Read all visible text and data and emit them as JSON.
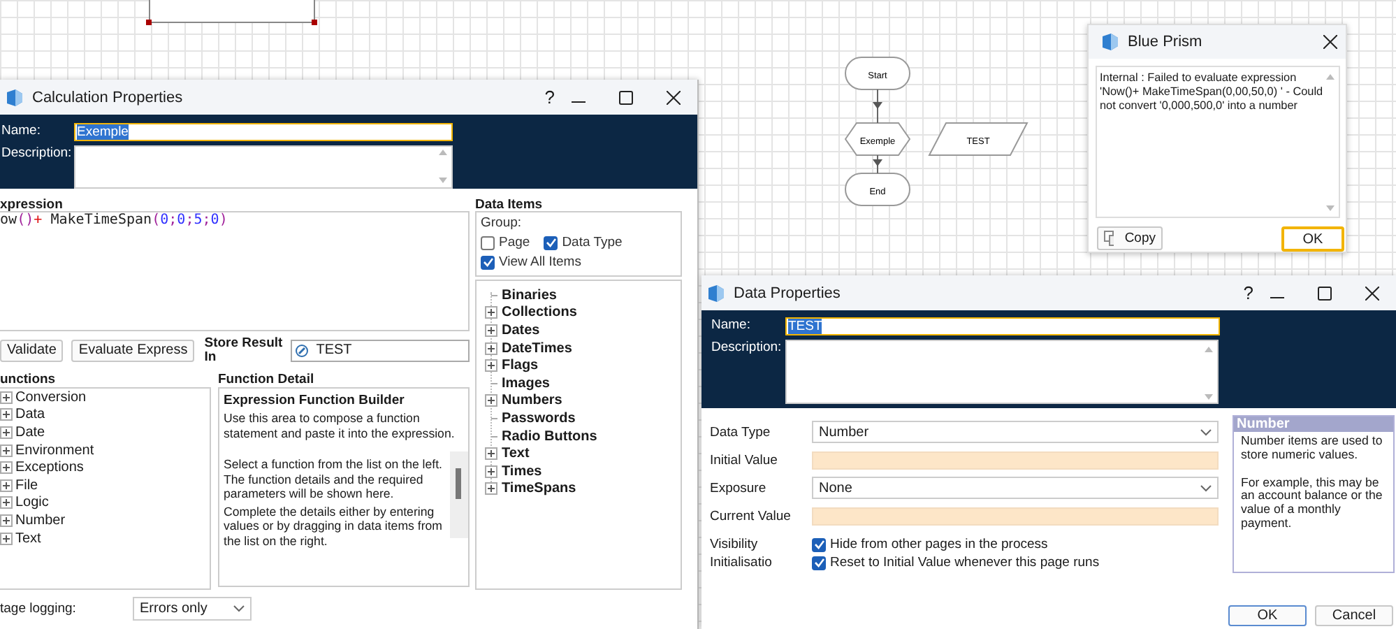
{
  "canvas": {
    "flowchart": [
      {
        "kind": "terminal",
        "label": "Start"
      },
      {
        "kind": "process",
        "label": "Exemple"
      },
      {
        "kind": "data",
        "label": "TEST"
      },
      {
        "kind": "terminal",
        "label": "End"
      }
    ]
  },
  "calculation": {
    "title": "Calculation Properties",
    "help": "?",
    "name_label": "Name:",
    "name": "Exemple",
    "name_selected": true,
    "description_label": "Description:",
    "expression_label": "xpression",
    "expression": "ow()+ MakeTimeSpan(0;0;5;0)",
    "buttons": [
      "Validate",
      "Evaluate Express"
    ],
    "store_result_label": "Store Result In",
    "store_result": "TEST",
    "functions_label": "unctions",
    "functions": [
      "Conversion",
      "Data",
      "Date",
      "Environment",
      "Exceptions",
      "File",
      "Logic",
      "Number",
      "Text"
    ],
    "function_detail_label": "Function Detail",
    "detail_title": "Expression Function Builder",
    "detail_intro": "Use this area to compose a function statement and paste it into the expression.",
    "detail_paragraphs": [
      "Select a function from the list on the left. The function details and the required parameters will be shown here.",
      "Complete the details either by entering values or by dragging in data items from the list on the right."
    ],
    "data_items_label": "Data Items",
    "group_label": "Group:",
    "group_options": [
      {
        "label": "Page",
        "checked": false
      },
      {
        "label": "Data Type",
        "checked": true
      },
      {
        "label": "View All Items",
        "checked": true
      }
    ],
    "data_items": [
      {
        "label": "Binaries",
        "expandable": false
      },
      {
        "label": "Collections",
        "expandable": true
      },
      {
        "label": "Dates",
        "expandable": true
      },
      {
        "label": "DateTimes",
        "expandable": true
      },
      {
        "label": "Flags",
        "expandable": true
      },
      {
        "label": "Images",
        "expandable": false
      },
      {
        "label": "Numbers",
        "expandable": true
      },
      {
        "label": "Passwords",
        "expandable": false
      },
      {
        "label": "Radio Buttons",
        "expandable": false
      },
      {
        "label": "Text",
        "expandable": true
      },
      {
        "label": "Times",
        "expandable": true
      },
      {
        "label": "TimeSpans",
        "expandable": true
      }
    ],
    "stage_logging_label": "tage logging:",
    "stage_logging": "Errors only"
  },
  "error_dialog": {
    "title": "Blue Prism",
    "message": "Internal : Failed to evaluate expression 'Now()+ MakeTimeSpan(0,00,50,0) ' - Could not convert '0,000,500,0' into a number",
    "copy": "Copy",
    "ok": "OK"
  },
  "data_properties": {
    "title": "Data Properties",
    "help": "?",
    "name_label": "Name:",
    "name": "TEST",
    "name_selected": true,
    "description_label": "Description:",
    "fields": [
      {
        "kind": "dropdown",
        "label": "Data Type",
        "value": "Number"
      },
      {
        "kind": "input",
        "label": "Initial Value"
      },
      {
        "kind": "dropdown",
        "label": "Exposure",
        "value": "None"
      },
      {
        "kind": "input",
        "label": "Current Value"
      },
      {
        "kind": "checkbox",
        "label": "Visibility",
        "text": "Hide from other pages in the process",
        "checked": true
      },
      {
        "kind": "checkbox",
        "label": "Initialisatio",
        "text": "Reset to Initial Value whenever this page runs",
        "checked": true
      }
    ],
    "info_title": "Number",
    "info_paragraphs": [
      "Number items are used to store numeric values.",
      "For example, this may be an account balance or the value of a monthly payment."
    ],
    "buttons": [
      "OK",
      "Cancel"
    ]
  }
}
